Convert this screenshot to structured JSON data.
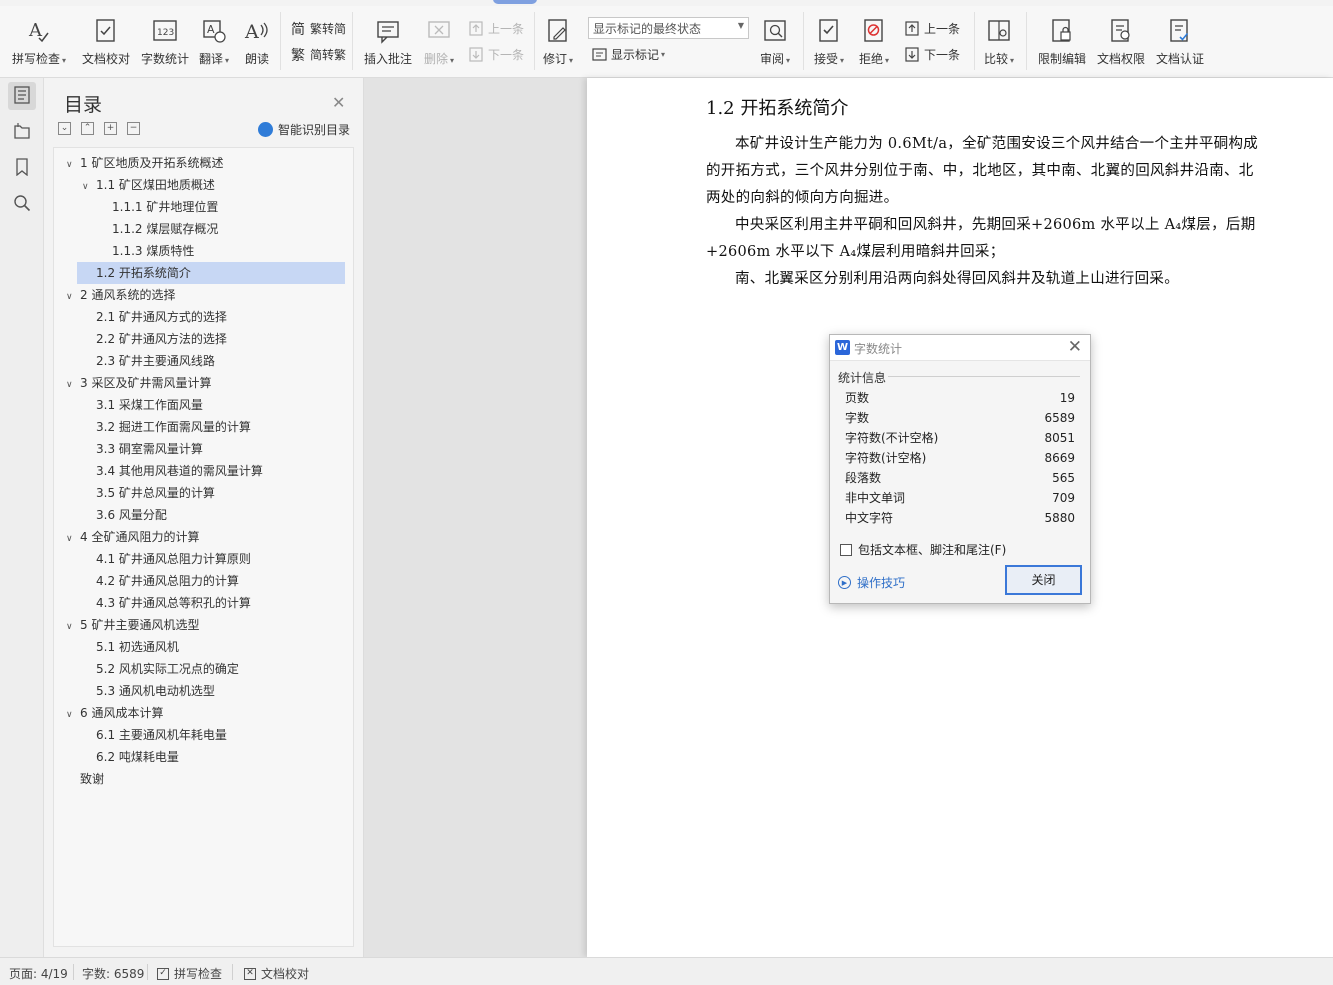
{
  "ribbon": {
    "spell_check": "拼写检查",
    "doc_proof": "文档校对",
    "word_count": "字数统计",
    "translate": "翻译",
    "read_aloud": "朗读",
    "trad_to_simp": "繁转简",
    "simp_to_trad": "简转繁",
    "insert_comment": "插入批注",
    "delete": "删除",
    "prev_comment": "上一条",
    "next_comment": "下一条",
    "track_changes": "修订",
    "markup_state": "显示标记的最终状态",
    "show_markup": "显示标记",
    "review": "审阅",
    "accept": "接受",
    "reject": "拒绝",
    "prev_change": "上一条",
    "next_change": "下一条",
    "compare": "比较",
    "restrict_edit": "限制编辑",
    "doc_permission": "文档权限",
    "doc_certify": "文档认证"
  },
  "toc": {
    "title": "目录",
    "smart_label": "智能识别目录",
    "items": [
      {
        "text": "1 矿区地质及开拓系统概述",
        "level": 1,
        "expanded": true
      },
      {
        "text": "1.1 矿区煤田地质概述",
        "level": 2,
        "expanded": true
      },
      {
        "text": "1.1.1 矿井地理位置",
        "level": 3
      },
      {
        "text": "1.1.2 煤层赋存概况",
        "level": 3
      },
      {
        "text": "1.1.3 煤质特性",
        "level": 3
      },
      {
        "text": "1.2 开拓系统简介",
        "level": 2,
        "selected": true
      },
      {
        "text": "2 通风系统的选择",
        "level": 1,
        "expanded": true
      },
      {
        "text": "2.1 矿井通风方式的选择",
        "level": 2
      },
      {
        "text": "2.2 矿井通风方法的选择",
        "level": 2
      },
      {
        "text": "2.3 矿井主要通风线路",
        "level": 2
      },
      {
        "text": "3 采区及矿井需风量计算",
        "level": 1,
        "expanded": true
      },
      {
        "text": "3.1 采煤工作面风量",
        "level": 2
      },
      {
        "text": "3.2 掘进工作面需风量的计算",
        "level": 2
      },
      {
        "text": "3.3 硐室需风量计算",
        "level": 2
      },
      {
        "text": "3.4 其他用风巷道的需风量计算",
        "level": 2
      },
      {
        "text": "3.5 矿井总风量的计算",
        "level": 2
      },
      {
        "text": "3.6 风量分配",
        "level": 2
      },
      {
        "text": "4 全矿通风阻力的计算",
        "level": 1,
        "expanded": true
      },
      {
        "text": "4.1 矿井通风总阻力计算原则",
        "level": 2
      },
      {
        "text": "4.2 矿井通风总阻力的计算",
        "level": 2
      },
      {
        "text": "4.3 矿井通风总等积孔的计算",
        "level": 2
      },
      {
        "text": "5 矿井主要通风机选型",
        "level": 1,
        "expanded": true
      },
      {
        "text": "5.1 初选通风机",
        "level": 2
      },
      {
        "text": "5.2 风机实际工况点的确定",
        "level": 2
      },
      {
        "text": "5.3 通风机电动机选型",
        "level": 2
      },
      {
        "text": "6 通风成本计算",
        "level": 1,
        "expanded": true
      },
      {
        "text": "6.1 主要通风机年耗电量",
        "level": 2
      },
      {
        "text": "6.2 吨煤耗电量",
        "level": 2
      },
      {
        "text": "致谢",
        "level": 1
      }
    ]
  },
  "document": {
    "heading": "1.2 开拓系统简介",
    "para1": "本矿井设计生产能力为 0.6Mt/a，全矿范围安设三个风井结合一个主井平硐构成的开拓方式，三个风井分别位于南、中，北地区，其中南、北翼的回风斜井沿南、北两处的向斜的倾向方向掘进。",
    "para2": "中央采区利用主井平硐和回风斜井，先期回采+2606m 水平以上 A₄煤层，后期+2606m 水平以下 A₄煤层利用暗斜井回采；",
    "para3": "南、北翼采区分别利用沿两向斜处得回风斜井及轨道上山进行回采。"
  },
  "dialog": {
    "title": "字数统计",
    "group_label": "统计信息",
    "stats": [
      {
        "label": "页数",
        "value": "19"
      },
      {
        "label": "字数",
        "value": "6589"
      },
      {
        "label": "字符数(不计空格)",
        "value": "8051"
      },
      {
        "label": "字符数(计空格)",
        "value": "8669"
      },
      {
        "label": "段落数",
        "value": "565"
      },
      {
        "label": "非中文单词",
        "value": "709"
      },
      {
        "label": "中文字符",
        "value": "5880"
      }
    ],
    "include_label": "包括文本框、脚注和尾注(F)",
    "include_checked": false,
    "tips_label": "操作技巧",
    "close_label": "关闭"
  },
  "status": {
    "page": "页面: 4/19",
    "words": "字数: 6589",
    "spell_check": "拼写检查",
    "doc_proof": "文档校对"
  },
  "colors": {
    "accent": "#3b78d8",
    "toc_selected": "#c7d7f4",
    "link": "#2f6fc8"
  }
}
